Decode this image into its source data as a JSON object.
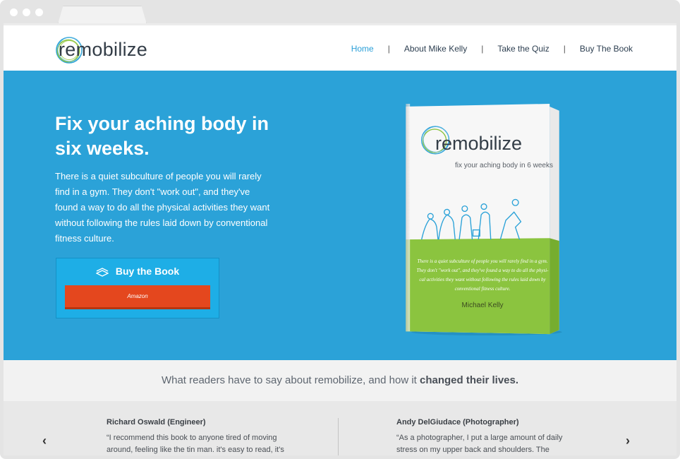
{
  "browser": {
    "tab_label": ""
  },
  "header": {
    "logo_re": "re",
    "logo_rest": "mobilize",
    "nav": [
      {
        "label": "Home",
        "active": true
      },
      {
        "label": "About Mike Kelly",
        "active": false
      },
      {
        "label": "Take the Quiz",
        "active": false
      },
      {
        "label": "Buy The Book",
        "active": false
      }
    ],
    "separator": "|"
  },
  "hero": {
    "title": "Fix your aching body in six weeks.",
    "text": "There is a quiet subculture of people you will rarely find in a gym. They don't \"work out\", and they've found a way to do all the physical activities they want without following the rules laid down by conventional fitness culture.",
    "buy_label": "Buy the Book",
    "amazon_label": "Amazon"
  },
  "book": {
    "title_re": "re",
    "title_rest": "mobilize",
    "subtitle": "fix your aching body in 6 weeks",
    "blurb_lines": [
      "There is a quiet subculture of people you will rarely find in a gym.",
      "They don't \"work out\", and they've found a way to do all the physi-",
      "cal activities they want without following the rules laid down by",
      "conventional fitness culture."
    ],
    "author": "Michael Kelly"
  },
  "testimonials": {
    "heading_pre": "What readers have to say about remobilize, and how it ",
    "heading_bold": "changed their lives.",
    "items": [
      {
        "name": "Richard Oswald (Engineer)",
        "body": "“I recommend this book to anyone tired of moving around, feeling like the tin man. it's easy to read, it's funny, and it"
      },
      {
        "name": "Andy DelGiudace (Photographer)",
        "body": "“As a photographer, I put a large amount of daily stress on my upper back and shoulders. The multistep program laid"
      }
    ],
    "prev_arrow": "‹",
    "next_arrow": "›"
  },
  "colors": {
    "hero_bg": "#2ba2d8",
    "accent": "#2a9fd8",
    "amazon": "#e4471e",
    "book_green": "#8bc43f"
  }
}
